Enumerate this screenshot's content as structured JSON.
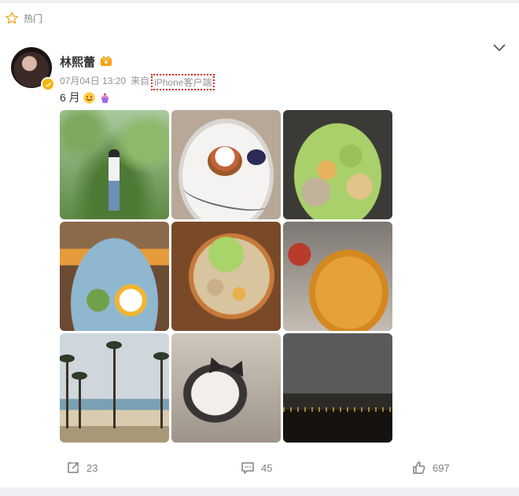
{
  "header": {
    "hot_label": "热门"
  },
  "post": {
    "username": "林熙蕾",
    "date": "07月04日 13:20",
    "source_prefix": "来自",
    "source": "iPhone客户端",
    "text": "6 月",
    "images": [
      "photo-1",
      "photo-2",
      "photo-3",
      "photo-4",
      "photo-5",
      "photo-6",
      "photo-7",
      "photo-8",
      "photo-9"
    ]
  },
  "actions": {
    "share_count": "23",
    "comment_count": "45",
    "like_count": "697"
  },
  "icons": [
    "star-icon",
    "chevron-down-icon",
    "crown-icon",
    "verified-icon",
    "emoji-icon",
    "cupcake-icon",
    "share-icon",
    "comment-icon",
    "like-icon"
  ],
  "colors": {
    "source_highlight": "#d81e06",
    "verified": "#f5b400",
    "star": "#f3a72a"
  }
}
